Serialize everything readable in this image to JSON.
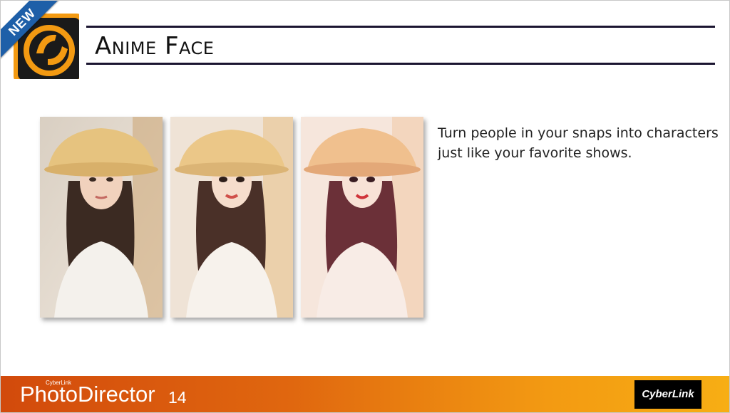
{
  "slide": {
    "title": "Anime Face",
    "badge": "NEW",
    "description": "Turn people in your snaps into characters just like your favorite shows."
  },
  "footer": {
    "brand_small": "CyberLink",
    "product": "PhotoDirector",
    "version": "14",
    "logo_text": "CyberLink"
  },
  "photos": [
    {
      "name": "original"
    },
    {
      "name": "anime-style-1"
    },
    {
      "name": "anime-style-2"
    }
  ],
  "colors": {
    "footer_start": "#d24a0c",
    "footer_end": "#f7ae14",
    "ribbon": "#1e5fa8",
    "logo_orange": "#f39a12"
  }
}
